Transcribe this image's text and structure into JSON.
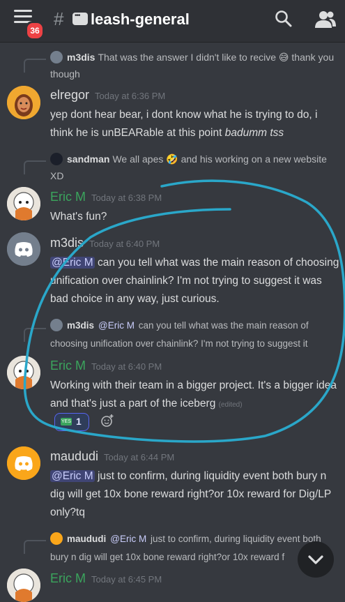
{
  "header": {
    "badge": "36",
    "hash": "#",
    "channel": "leash-general"
  },
  "messages": {
    "r1": {
      "name": "m3dis",
      "text": "That was the answer I didn't like to recive 😅 thank you though"
    },
    "elregor": {
      "name": "elregor",
      "time": "Today at 6:36 PM",
      "line1": "yep dont hear bear, i dont know what he is trying to do, i",
      "line2": "think he is unBEARable at this point ",
      "italic": "badumm tss"
    },
    "r2": {
      "name": "sandman",
      "text": "We all apes 🤣 and his working on a new website XD"
    },
    "eric1": {
      "name": "Eric M",
      "time": "Today at 6:38 PM",
      "text": "What's fun?"
    },
    "m3dis": {
      "name": "m3dis",
      "time": "Today at 6:40 PM",
      "mention": "@Eric M",
      "text": " can you tell what was the main reason of choosing unification over chainlink? I'm not trying to suggest it was bad choice in any way, just curious."
    },
    "r3": {
      "name": "m3dis",
      "mention": "@Eric M",
      "text": " can you tell what was the main reason of choosing unification over chainlink? I'm not trying to suggest it"
    },
    "eric2": {
      "name": "Eric M",
      "time": "Today at 6:40 PM",
      "text": "Working with their team in a bigger project. It's a bigger idea and that's just a part of the iceberg ",
      "edited": "(edited)",
      "reaction_count": "1",
      "reaction_emoji": "YES"
    },
    "maududi": {
      "name": "maududi",
      "time": "Today at 6:44 PM",
      "mention": "@Eric M",
      "text": " just to confirm, during liquidity event both bury n dig will get 10x bone reward right?or 10x reward for Dig/LP only?tq"
    },
    "r4": {
      "name": "maududi",
      "mention": "@Eric M",
      "text": " just to confirm, during liquidity event both bury n dig will get 10x bone reward right?or 10x reward f"
    },
    "eric3": {
      "name": "Eric M",
      "time": "Today at 6:45 PM"
    }
  },
  "colors": {
    "eric": "#3ba55d",
    "discord_blue": "#5865f2",
    "orange": "#faa61a",
    "annotation": "#2aa7c9"
  }
}
